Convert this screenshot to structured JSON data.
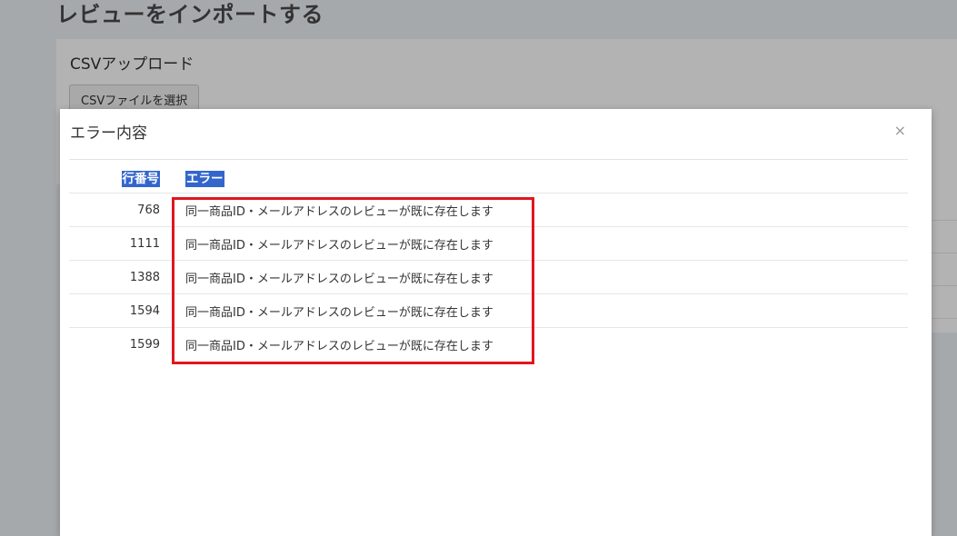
{
  "page": {
    "title": "レビューをインポートする"
  },
  "upload": {
    "title": "CSVアップロード",
    "choose_button": "CSVファイルを選択"
  },
  "modal": {
    "title": "エラー内容",
    "close": "×",
    "table": {
      "headers": {
        "row_number": "行番号",
        "error": "エラー"
      },
      "rows": [
        {
          "row_number": "768",
          "error": "同一商品ID・メールアドレスのレビューが既に存在します"
        },
        {
          "row_number": "1111",
          "error": "同一商品ID・メールアドレスのレビューが既に存在します"
        },
        {
          "row_number": "1388",
          "error": "同一商品ID・メールアドレスのレビューが既に存在します"
        },
        {
          "row_number": "1594",
          "error": "同一商品ID・メールアドレスのレビューが既に存在します"
        },
        {
          "row_number": "1599",
          "error": "同一商品ID・メールアドレスのレビューが既に存在します"
        }
      ]
    }
  },
  "colors": {
    "header_highlight": "#3366cc",
    "annotation_box": "#e0161e",
    "backdrop": "#a6a9ac"
  }
}
